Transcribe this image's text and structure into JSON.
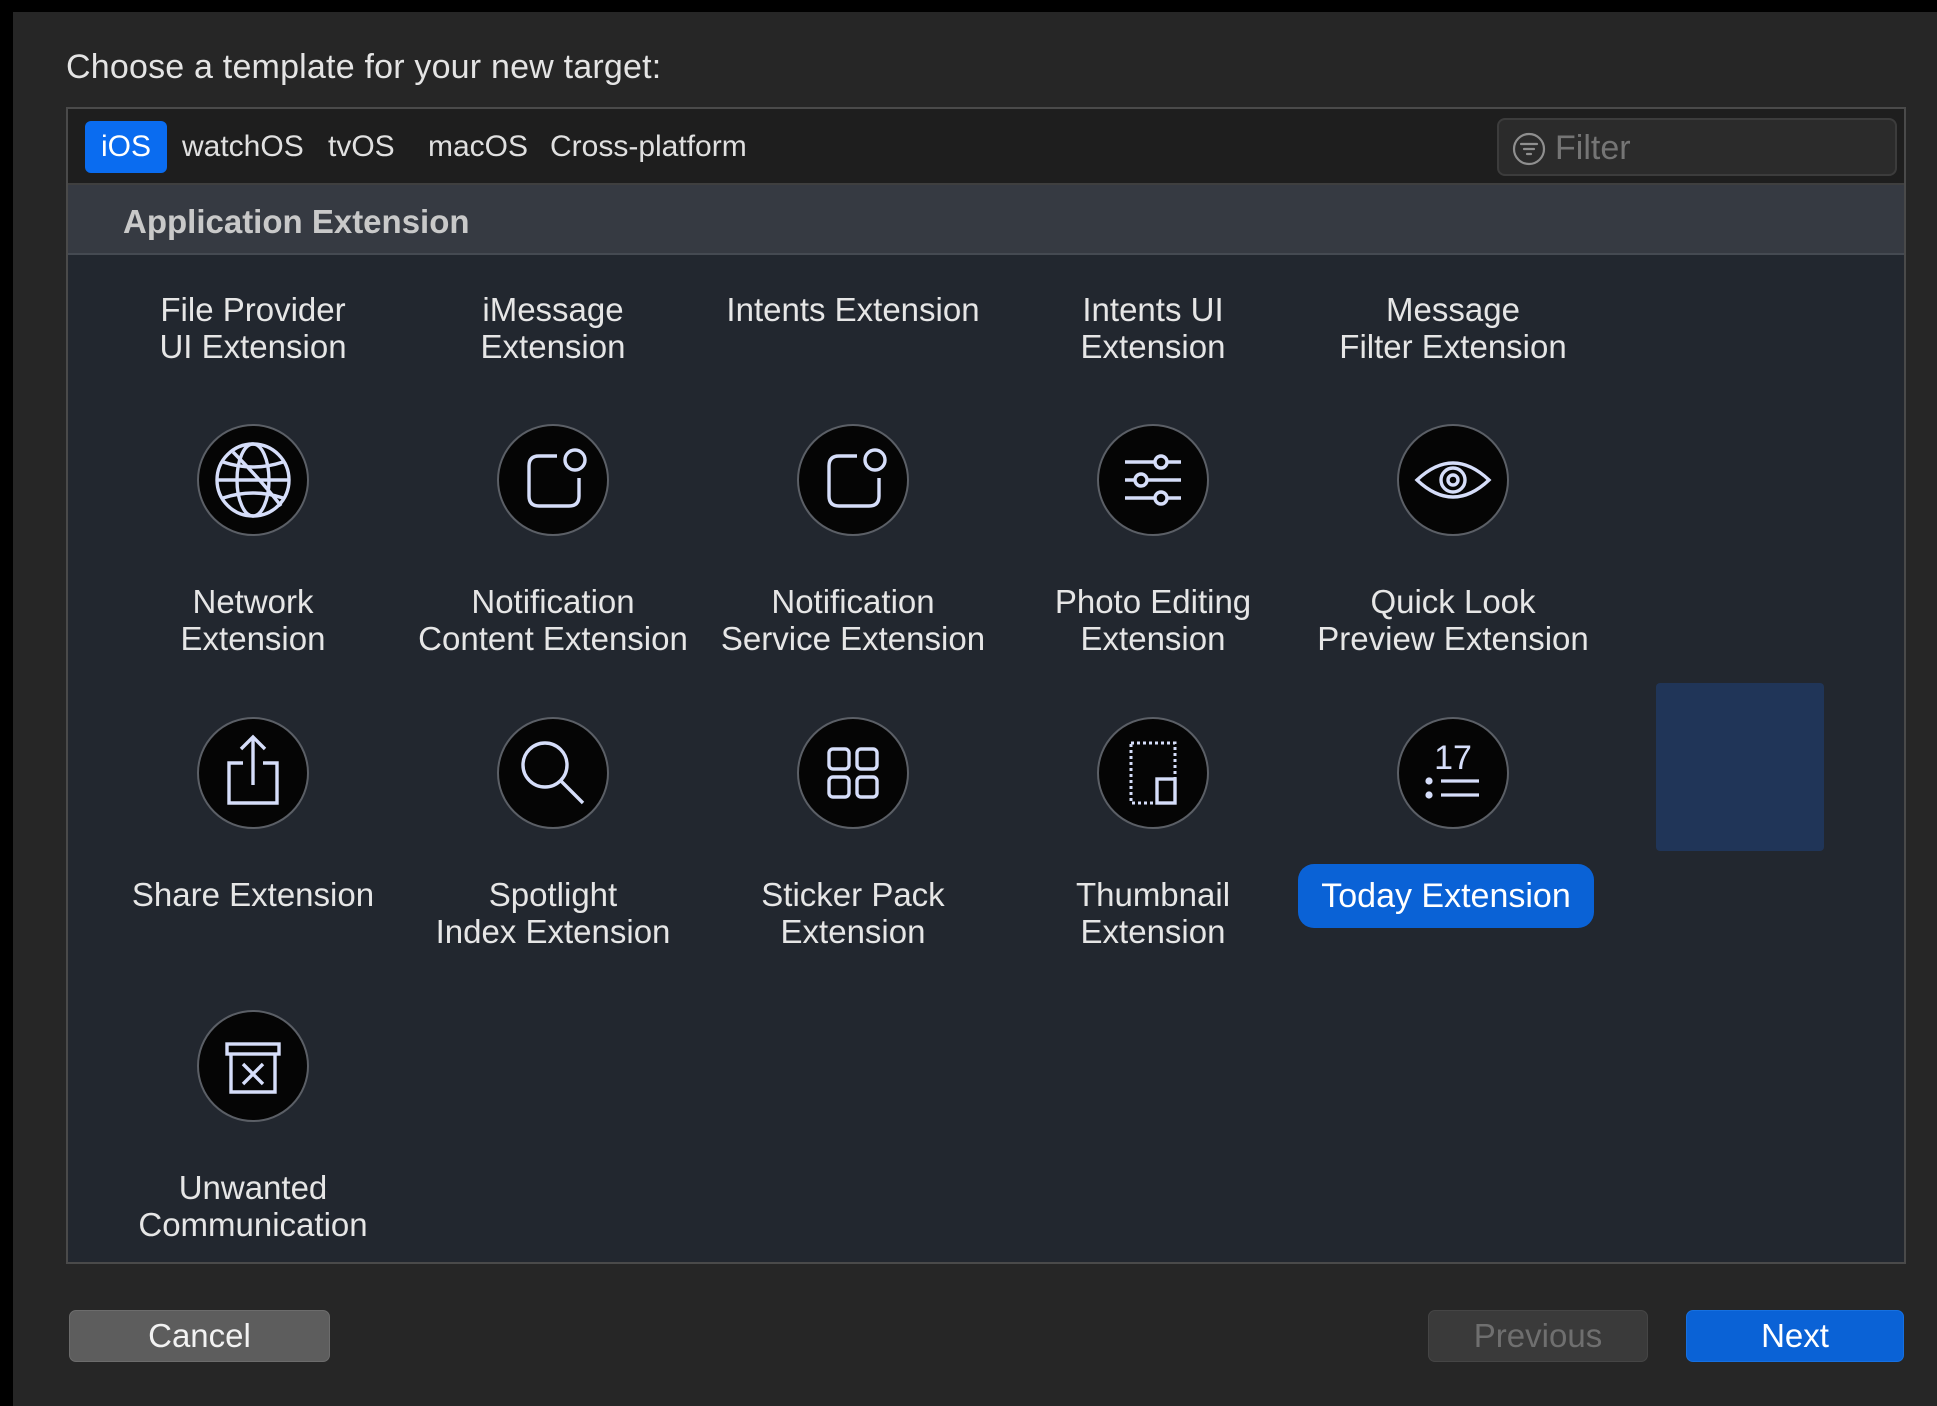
{
  "prompt": "Choose a template for your new target:",
  "tabs": [
    {
      "label": "iOS",
      "selected": true
    },
    {
      "label": "watchOS",
      "selected": false
    },
    {
      "label": "tvOS",
      "selected": false
    },
    {
      "label": "macOS",
      "selected": false
    },
    {
      "label": "Cross-platform",
      "selected": false
    }
  ],
  "filter": {
    "placeholder": "Filter",
    "value": "",
    "icon": "filter-icon"
  },
  "section": {
    "title": "Application Extension"
  },
  "row0_labels": [
    {
      "line1": "File Provider",
      "line2": "UI Extension"
    },
    {
      "line1": "iMessage",
      "line2": "Extension"
    },
    {
      "line1": "Intents Extension",
      "line2": ""
    },
    {
      "line1": "Intents UI",
      "line2": "Extension"
    },
    {
      "line1": "Message",
      "line2": "Filter Extension"
    }
  ],
  "templates": [
    {
      "icon": "globe-icon",
      "line1": "Network",
      "line2": "Extension",
      "selected": false
    },
    {
      "icon": "notification-badge-icon",
      "line1": "Notification",
      "line2": "Content Extension",
      "selected": false
    },
    {
      "icon": "notification-badge-icon",
      "line1": "Notification",
      "line2": "Service Extension",
      "selected": false
    },
    {
      "icon": "sliders-icon",
      "line1": "Photo Editing",
      "line2": "Extension",
      "selected": false
    },
    {
      "icon": "eye-icon",
      "line1": "Quick Look",
      "line2": "Preview Extension",
      "selected": false
    },
    {
      "icon": "share-icon",
      "line1": "Share Extension",
      "line2": "",
      "selected": false
    },
    {
      "icon": "magnifier-icon",
      "line1": "Spotlight",
      "line2": "Index Extension",
      "selected": false
    },
    {
      "icon": "grid-icon",
      "line1": "Sticker Pack",
      "line2": "Extension",
      "selected": false
    },
    {
      "icon": "thumbnail-icon",
      "line1": "Thumbnail",
      "line2": "Extension",
      "selected": false
    },
    {
      "icon": "calendar-list-icon",
      "line1": "Today Extension",
      "line2": "",
      "selected": true,
      "icon_text": "17"
    },
    {
      "icon": "junk-box-icon",
      "line1": "Unwanted",
      "line2": "Communication",
      "selected": false
    }
  ],
  "buttons": {
    "cancel": "Cancel",
    "previous": "Previous",
    "next": "Next"
  },
  "colors": {
    "accent": "#0a62d6",
    "selection_bg": "#203558",
    "panel_bg": "#22272f",
    "window_bg": "#262626"
  }
}
